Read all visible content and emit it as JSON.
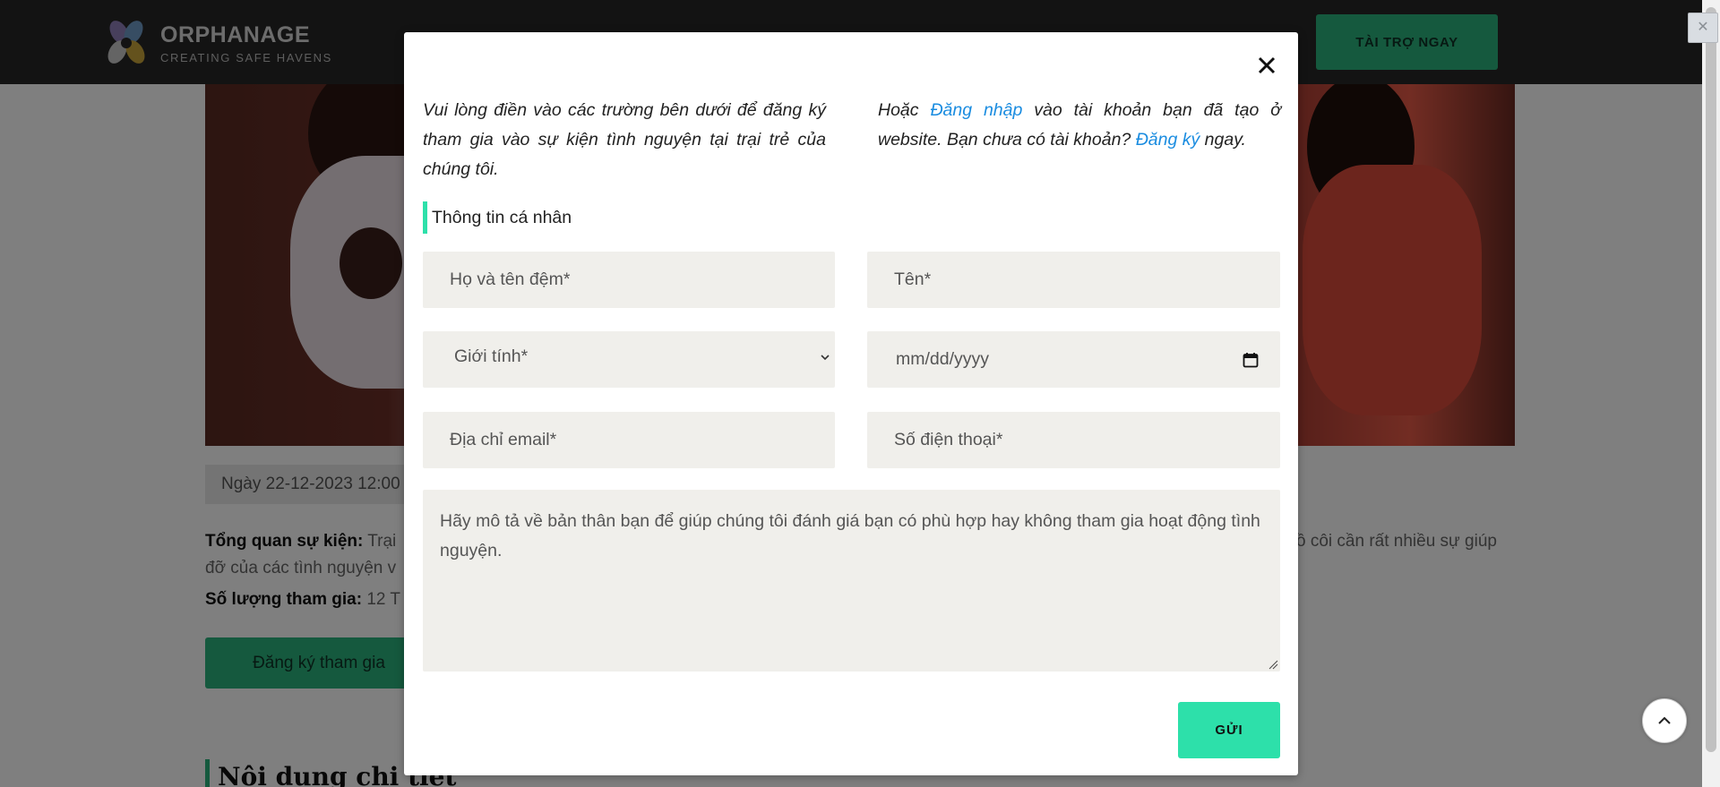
{
  "header": {
    "brand_title": "ORPHANAGE",
    "brand_subtitle": "CREATING SAFE HAVENS",
    "donate_label": "TÀI TRỢ NGAY"
  },
  "event": {
    "date_text": "Ngày 22-12-2023 12:00",
    "overview_label": "Tổng quan sự kiện:",
    "overview_text_left": "Trại",
    "overview_text_right": "ồ côi cần rất nhiều sự giúp",
    "overview_line2": "đỡ của các tình nguyện v",
    "count_label": "Số lượng tham gia:",
    "count_value": "12 T",
    "register_label": "Đăng ký tham gia",
    "detail_heading": "Nội dung chi tiết"
  },
  "modal": {
    "intro_left": "Vui lòng điền vào các trường bên dưới để đăng ký tham gia vào sự kiện tình nguyện tại trại trẻ của chúng tôi.",
    "intro_right_prefix": "Hoặc ",
    "login_link": "Đăng nhập",
    "intro_right_middle": " vào tài khoản bạn đã tạo ở website. Bạn chưa có tài khoản? ",
    "signup_link": "Đăng ký",
    "intro_right_suffix": " ngay.",
    "section_label": "Thông tin cá nhân",
    "fields": {
      "last_name_placeholder": "Họ và tên đệm*",
      "first_name_placeholder": "Tên*",
      "gender_placeholder": "Giới tính*",
      "dob_placeholder": "mm/dd/yyyy",
      "email_placeholder": "Địa chỉ email*",
      "phone_placeholder": "Số điện thoại*",
      "description_placeholder": "Hãy mô tả về bản thân bạn để giúp chúng tôi đánh giá bạn có phù hợp hay không tham gia hoạt động tình nguyện."
    },
    "submit_label": "GỬI"
  },
  "colors": {
    "accent_green": "#2bb27c",
    "modal_accent": "#2de0aa",
    "link_blue": "#1a8ce0",
    "header_bg": "#262626"
  },
  "icons": {
    "close": "close-icon",
    "scroll_top": "chevron-up-icon",
    "calendar": "calendar-icon",
    "select": "chevron-down-icon"
  }
}
